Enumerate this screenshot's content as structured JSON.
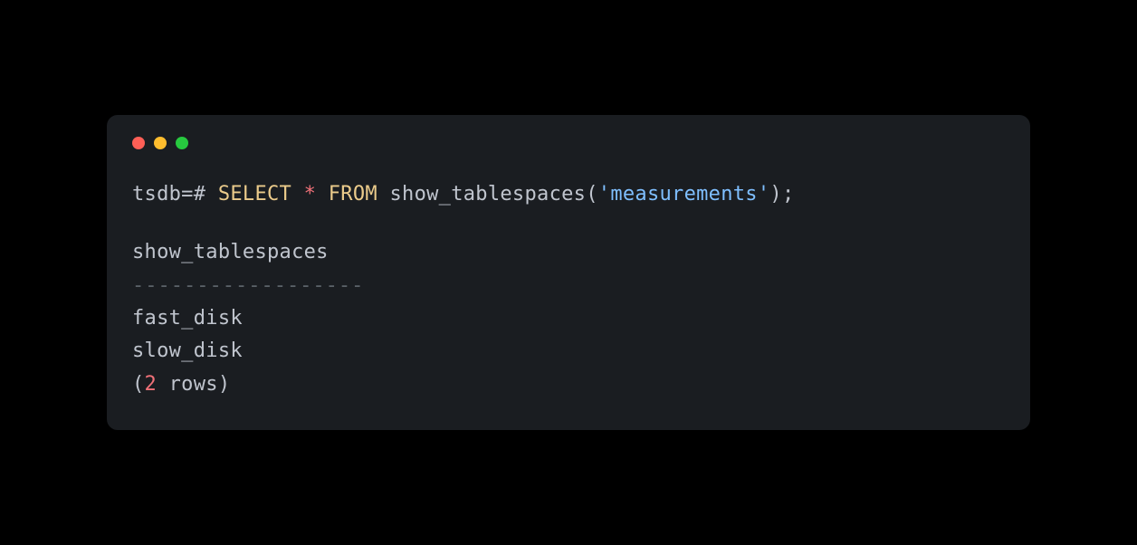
{
  "terminal": {
    "prompt": "tsdb=# ",
    "query": {
      "select": "SELECT",
      "star": "*",
      "from": "FROM",
      "function": "show_tablespaces",
      "open_paren": "(",
      "quote1": "'",
      "argument": "measurements",
      "quote2": "'",
      "close_paren": ")",
      "semicolon": ";"
    },
    "result": {
      "column_header": "show_tablespaces",
      "divider": "------------------",
      "rows": [
        " fast_disk",
        " slow_disk"
      ],
      "footer_open": "(",
      "row_count": "2",
      "footer_text": " rows",
      "footer_close": ")"
    }
  }
}
